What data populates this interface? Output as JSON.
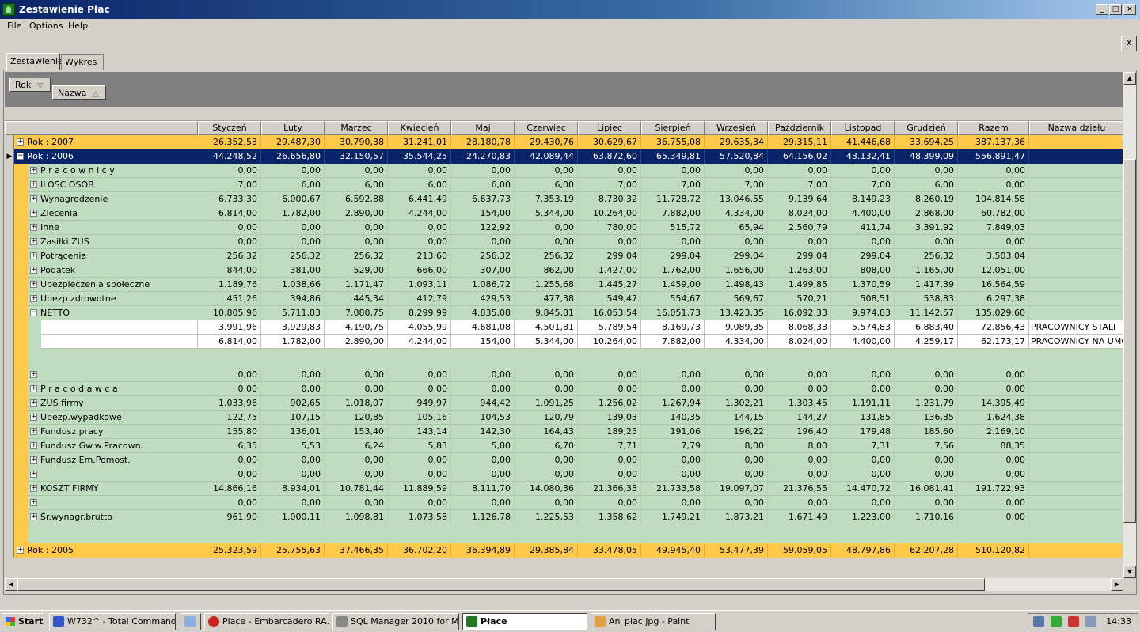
{
  "window": {
    "title": "Zestawienie Płac",
    "min": "_",
    "max": "□",
    "close": "×"
  },
  "menu": [
    "File",
    "Options",
    "Help"
  ],
  "close_panel": "X",
  "tabs": [
    "Zestawienie",
    "Wykres"
  ],
  "group_panel": {
    "rok": "Rok",
    "nazwa": "Nazwa"
  },
  "columns": [
    "Styczeń",
    "Luty",
    "Marzec",
    "Kwiecień",
    "Maj",
    "Czerwiec",
    "Lipiec",
    "Sierpień",
    "Wrzesień",
    "Październik",
    "Listopad",
    "Grudzień",
    "Razem",
    "Nazwa działu"
  ],
  "rows": [
    {
      "type": "year",
      "label": "Rok : 2007",
      "values": [
        "26.352,53",
        "29.487,30",
        "30.790,38",
        "31.241,01",
        "28.180,78",
        "29.430,76",
        "30.629,67",
        "36.755,08",
        "29.635,34",
        "29.315,11",
        "41.446,68",
        "33.694,25",
        "387.137,36",
        ""
      ]
    },
    {
      "type": "yearsel",
      "label": "Rok : 2006",
      "values": [
        "44.248,52",
        "26.656,80",
        "32.150,57",
        "35.544,25",
        "24.270,83",
        "42.089,44",
        "63.872,60",
        "65.349,81",
        "57.520,84",
        "64.156,02",
        "43.132,41",
        "48.399,09",
        "556.891,47",
        ""
      ]
    },
    {
      "type": "cat",
      "label": "P r a c o w n i c y",
      "values": [
        "0,00",
        "0,00",
        "0,00",
        "0,00",
        "0,00",
        "0,00",
        "0,00",
        "0,00",
        "0,00",
        "0,00",
        "0,00",
        "0,00",
        "0,00",
        ""
      ]
    },
    {
      "type": "cat",
      "label": "ILOŚĆ OSÓB",
      "values": [
        "7,00",
        "6,00",
        "6,00",
        "6,00",
        "6,00",
        "6,00",
        "7,00",
        "7,00",
        "7,00",
        "7,00",
        "7,00",
        "6,00",
        "0,00",
        ""
      ]
    },
    {
      "type": "cat",
      "label": "Wynagrodzenie",
      "values": [
        "6.733,30",
        "6.000,67",
        "6.592,88",
        "6.441,49",
        "6.637,73",
        "7.353,19",
        "8.730,32",
        "11.728,72",
        "13.046,55",
        "9.139,64",
        "8.149,23",
        "8.260,19",
        "104.814,58",
        ""
      ]
    },
    {
      "type": "cat",
      "label": "Zlecenia",
      "values": [
        "6.814,00",
        "1.782,00",
        "2.890,00",
        "4.244,00",
        "154,00",
        "5.344,00",
        "10.264,00",
        "7.882,00",
        "4.334,00",
        "8.024,00",
        "4.400,00",
        "2.868,00",
        "60.782,00",
        ""
      ]
    },
    {
      "type": "cat",
      "label": "Inne",
      "values": [
        "0,00",
        "0,00",
        "0,00",
        "0,00",
        "122,92",
        "0,00",
        "780,00",
        "515,72",
        "65,94",
        "2.560,79",
        "411,74",
        "3.391,92",
        "7.849,03",
        ""
      ]
    },
    {
      "type": "cat",
      "label": "Zasiłki ZUS",
      "values": [
        "0,00",
        "0,00",
        "0,00",
        "0,00",
        "0,00",
        "0,00",
        "0,00",
        "0,00",
        "0,00",
        "0,00",
        "0,00",
        "0,00",
        "0,00",
        ""
      ]
    },
    {
      "type": "cat",
      "label": "Potrącenia",
      "values": [
        "256,32",
        "256,32",
        "256,32",
        "213,60",
        "256,32",
        "256,32",
        "299,04",
        "299,04",
        "299,04",
        "299,04",
        "299,04",
        "256,32",
        "3.503,04",
        ""
      ]
    },
    {
      "type": "cat",
      "label": "Podatek",
      "values": [
        "844,00",
        "381,00",
        "529,00",
        "666,00",
        "307,00",
        "862,00",
        "1.427,00",
        "1.762,00",
        "1.656,00",
        "1.263,00",
        "808,00",
        "1.165,00",
        "12.051,00",
        ""
      ]
    },
    {
      "type": "cat",
      "label": "Ubezpieczenia społeczne",
      "values": [
        "1.189,76",
        "1.038,66",
        "1.171,47",
        "1.093,11",
        "1.086,72",
        "1.255,68",
        "1.445,27",
        "1.459,00",
        "1.498,43",
        "1.499,85",
        "1.370,59",
        "1.417,39",
        "16.564,59",
        ""
      ]
    },
    {
      "type": "cat",
      "label": "Ubezp.zdrowotne",
      "values": [
        "451,26",
        "394,86",
        "445,34",
        "412,79",
        "429,53",
        "477,38",
        "549,47",
        "554,67",
        "569,67",
        "570,21",
        "508,51",
        "538,83",
        "6.297,38",
        ""
      ]
    },
    {
      "type": "catopen",
      "label": "NETTO",
      "values": [
        "10.805,96",
        "5.711,83",
        "7.080,75",
        "8.299,99",
        "4.835,08",
        "9.845,81",
        "16.053,54",
        "16.051,73",
        "13.423,35",
        "16.092,33",
        "9.974,83",
        "11.142,57",
        "135.029,60",
        ""
      ]
    },
    {
      "type": "det",
      "label": "",
      "values": [
        "3.991,96",
        "3.929,83",
        "4.190,75",
        "4.055,99",
        "4.681,08",
        "4.501,81",
        "5.789,54",
        "8.169,73",
        "9.089,35",
        "8.068,33",
        "5.574,83",
        "6.883,40",
        "72.856,43",
        "PRACOWNICY STALI"
      ]
    },
    {
      "type": "det",
      "label": "",
      "values": [
        "6.814,00",
        "1.782,00",
        "2.890,00",
        "4.244,00",
        "154,00",
        "5.344,00",
        "10.264,00",
        "7.882,00",
        "4.334,00",
        "8.024,00",
        "4.400,00",
        "4.259,17",
        "62.173,17",
        "PRACOWNICY NA UMOWĘ"
      ]
    },
    {
      "type": "blank",
      "label": "",
      "values": []
    },
    {
      "type": "cat",
      "label": "",
      "values": [
        "0,00",
        "0,00",
        "0,00",
        "0,00",
        "0,00",
        "0,00",
        "0,00",
        "0,00",
        "0,00",
        "0,00",
        "0,00",
        "0,00",
        "0,00",
        ""
      ]
    },
    {
      "type": "cat",
      "label": "P r a c o d a w c a",
      "values": [
        "0,00",
        "0,00",
        "0,00",
        "0,00",
        "0,00",
        "0,00",
        "0,00",
        "0,00",
        "0,00",
        "0,00",
        "0,00",
        "0,00",
        "0,00",
        ""
      ]
    },
    {
      "type": "cat",
      "label": "ZUS firmy",
      "values": [
        "1.033,96",
        "902,65",
        "1.018,07",
        "949,97",
        "944,42",
        "1.091,25",
        "1.256,02",
        "1.267,94",
        "1.302,21",
        "1.303,45",
        "1.191,11",
        "1.231,79",
        "14.395,49",
        ""
      ]
    },
    {
      "type": "cat",
      "label": "Ubezp.wypadkowe",
      "values": [
        "122,75",
        "107,15",
        "120,85",
        "105,16",
        "104,53",
        "120,79",
        "139,03",
        "140,35",
        "144,15",
        "144,27",
        "131,85",
        "136,35",
        "1.624,38",
        ""
      ]
    },
    {
      "type": "cat",
      "label": "Fundusz pracy",
      "values": [
        "155,80",
        "136,01",
        "153,40",
        "143,14",
        "142,30",
        "164,43",
        "189,25",
        "191,06",
        "196,22",
        "196,40",
        "179,48",
        "185,60",
        "2.169,10",
        ""
      ]
    },
    {
      "type": "cat",
      "label": "Fundusz Gw.w.Pracown.",
      "values": [
        "6,35",
        "5,53",
        "6,24",
        "5,83",
        "5,80",
        "6,70",
        "7,71",
        "7,79",
        "8,00",
        "8,00",
        "7,31",
        "7,56",
        "88,35",
        ""
      ]
    },
    {
      "type": "cat",
      "label": "Fundusz Em.Pomost.",
      "values": [
        "0,00",
        "0,00",
        "0,00",
        "0,00",
        "0,00",
        "0,00",
        "0,00",
        "0,00",
        "0,00",
        "0,00",
        "0,00",
        "0,00",
        "0,00",
        ""
      ]
    },
    {
      "type": "cat",
      "label": "",
      "values": [
        "0,00",
        "0,00",
        "0,00",
        "0,00",
        "0,00",
        "0,00",
        "0,00",
        "0,00",
        "0,00",
        "0,00",
        "0,00",
        "0,00",
        "0,00",
        ""
      ]
    },
    {
      "type": "cat",
      "label": "KOSZT FIRMY",
      "values": [
        "14.866,16",
        "8.934,01",
        "10.781,44",
        "11.889,59",
        "8.111,70",
        "14.080,36",
        "21.366,33",
        "21.733,58",
        "19.097,07",
        "21.376,55",
        "14.470,72",
        "16.081,41",
        "191.722,93",
        ""
      ]
    },
    {
      "type": "cat",
      "label": "",
      "values": [
        "0,00",
        "0,00",
        "0,00",
        "0,00",
        "0,00",
        "0,00",
        "0,00",
        "0,00",
        "0,00",
        "0,00",
        "0,00",
        "0,00",
        "0,00",
        ""
      ]
    },
    {
      "type": "cat",
      "label": "Śr.wynagr.brutto",
      "values": [
        "961,90",
        "1.000,11",
        "1.098,81",
        "1.073,58",
        "1.126,78",
        "1.225,53",
        "1.358,62",
        "1.749,21",
        "1.873,21",
        "1.671,49",
        "1.223,00",
        "1.710,16",
        "0,00",
        ""
      ]
    },
    {
      "type": "blank",
      "label": "",
      "values": []
    },
    {
      "type": "year",
      "label": "Rok : 2005",
      "values": [
        "25.323,59",
        "25.755,63",
        "37.466,35",
        "36.702,20",
        "36.394,89",
        "29.385,84",
        "33.478,05",
        "49.945,40",
        "53.477,39",
        "59.059,05",
        "48.797,86",
        "62.207,28",
        "510.120,82",
        ""
      ]
    }
  ],
  "taskbar": {
    "start": "Start",
    "tasks": [
      "W732^ - Total Command...",
      "",
      "Place - Embarcadero RA...",
      "SQL Manager 2010 for M...",
      "Płace",
      "An_plac.jpg - Paint"
    ],
    "clock": "14:33"
  },
  "colors": {
    "year": "#ffc94a",
    "selected": "#0a246a",
    "category": "#c0dcc0"
  }
}
